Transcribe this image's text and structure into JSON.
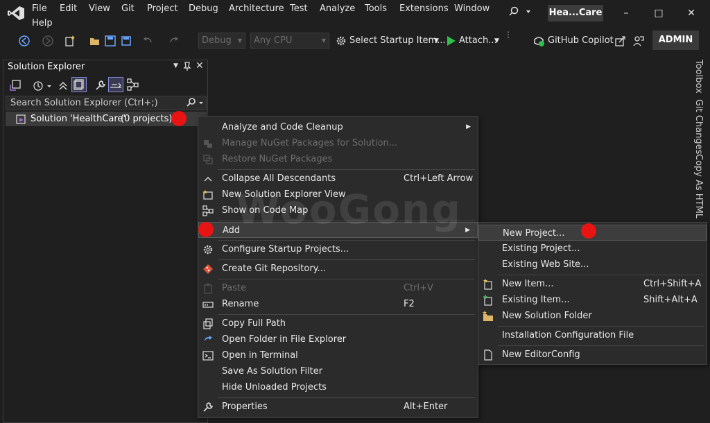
{
  "menu": [
    "File",
    "Edit",
    "View",
    "Git",
    "Project",
    "Debug",
    "Architecture",
    "Test",
    "Analyze",
    "Tools",
    "Extensions",
    "Window",
    "Help"
  ],
  "title_badge": "Hea...Care",
  "toolbar": {
    "config": "Debug",
    "platform": "Any CPU",
    "startup": "Select Startup Item...",
    "attach": "Attach...",
    "copilot": "GitHub Copilot",
    "admin": "ADMIN"
  },
  "solution_explorer": {
    "title": "Solution Explorer",
    "search_placeholder": "Search Solution Explorer (Ctrl+;)",
    "solution_label": "Solution 'HealthCare'",
    "projects_count": "(0 projects)"
  },
  "side_tabs": [
    "Toolbox",
    "Git Changes",
    "Copy As HTML"
  ],
  "watermark": "WooGong",
  "context_menu": [
    {
      "label": "Analyze and Code Cleanup",
      "shortcut": "",
      "disabled": false,
      "submenu": true,
      "icon": ""
    },
    {
      "label": "Manage NuGet Packages for Solution...",
      "shortcut": "",
      "disabled": true,
      "icon": "nuget-icon"
    },
    {
      "label": "Restore NuGet Packages",
      "shortcut": "",
      "disabled": true,
      "icon": "restore-icon"
    },
    {
      "label": "Collapse All Descendants",
      "shortcut": "Ctrl+Left Arrow",
      "disabled": false,
      "icon": "collapse-icon"
    },
    {
      "label": "New Solution Explorer View",
      "shortcut": "",
      "disabled": false,
      "icon": "new-view-icon"
    },
    {
      "label": "Show on Code Map",
      "shortcut": "",
      "disabled": false,
      "icon": "code-map-icon"
    },
    {
      "label": "Add",
      "shortcut": "",
      "disabled": false,
      "submenu": true,
      "icon": ""
    },
    {
      "label": "Configure Startup Projects...",
      "shortcut": "",
      "disabled": false,
      "icon": "gear-icon"
    },
    {
      "label": "Create Git Repository...",
      "shortcut": "",
      "disabled": false,
      "icon": "git-icon"
    },
    {
      "label": "Paste",
      "shortcut": "Ctrl+V",
      "disabled": true,
      "icon": "paste-icon"
    },
    {
      "label": "Rename",
      "shortcut": "F2",
      "disabled": false,
      "icon": "rename-icon"
    },
    {
      "label": "Copy Full Path",
      "shortcut": "",
      "disabled": false,
      "icon": "copy-icon"
    },
    {
      "label": "Open Folder in File Explorer",
      "shortcut": "",
      "disabled": false,
      "icon": "open-folder-icon"
    },
    {
      "label": "Open in Terminal",
      "shortcut": "",
      "disabled": false,
      "icon": "terminal-icon"
    },
    {
      "label": "Save As Solution Filter",
      "shortcut": "",
      "disabled": false,
      "icon": ""
    },
    {
      "label": "Hide Unloaded Projects",
      "shortcut": "",
      "disabled": false,
      "icon": ""
    },
    {
      "label": "Properties",
      "shortcut": "Alt+Enter",
      "disabled": false,
      "icon": "wrench-icon"
    }
  ],
  "add_submenu": [
    {
      "label": "New Project...",
      "shortcut": "",
      "icon": ""
    },
    {
      "label": "Existing Project...",
      "shortcut": "",
      "icon": ""
    },
    {
      "label": "Existing Web Site...",
      "shortcut": "",
      "icon": ""
    },
    {
      "label": "New Item...",
      "shortcut": "Ctrl+Shift+A",
      "icon": "new-item-icon"
    },
    {
      "label": "Existing Item...",
      "shortcut": "Shift+Alt+A",
      "icon": "existing-item-icon"
    },
    {
      "label": "New Solution Folder",
      "shortcut": "",
      "icon": "folder-icon"
    },
    {
      "label": "Installation Configuration File",
      "shortcut": "",
      "icon": ""
    },
    {
      "label": "New EditorConfig",
      "shortcut": "",
      "icon": "editorconfig-icon"
    }
  ],
  "colors": {
    "background": "#1f1f1f",
    "menu_bg": "#2b2b2b",
    "highlight_marker": "#e81313",
    "accent_play": "#2fbf4a",
    "vs_purple": "#9a6ee0"
  }
}
